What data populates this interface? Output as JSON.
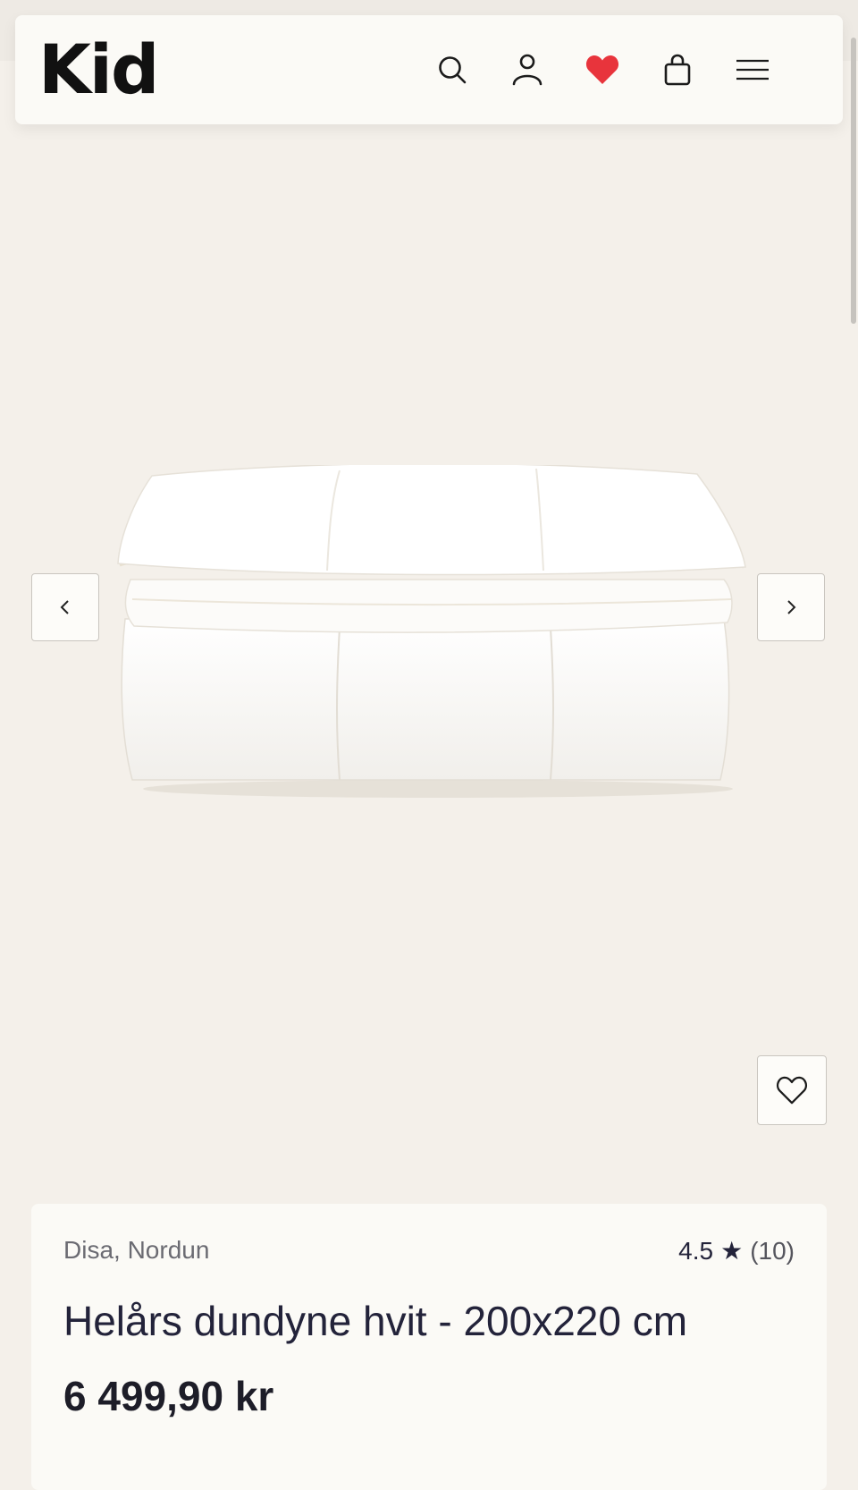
{
  "header": {
    "logo": "Kid",
    "icons": [
      "search-icon",
      "user-icon",
      "heart-icon",
      "bag-icon",
      "menu-icon"
    ]
  },
  "colors": {
    "background": "#f4f0ea",
    "card": "#fbfaf6",
    "heart_accent": "#e8343c",
    "text": "#23233a"
  },
  "gallery": {
    "prev_icon": "chevron-left-icon",
    "next_icon": "chevron-right-icon",
    "favorite_icon": "heart-outline-icon"
  },
  "product": {
    "brand": "Disa, Nordun",
    "rating_value": "4.5",
    "rating_star": "★",
    "rating_count": "(10)",
    "title": "Helårs dundyne hvit - 200x220 cm",
    "price": "6 499,90 kr"
  }
}
